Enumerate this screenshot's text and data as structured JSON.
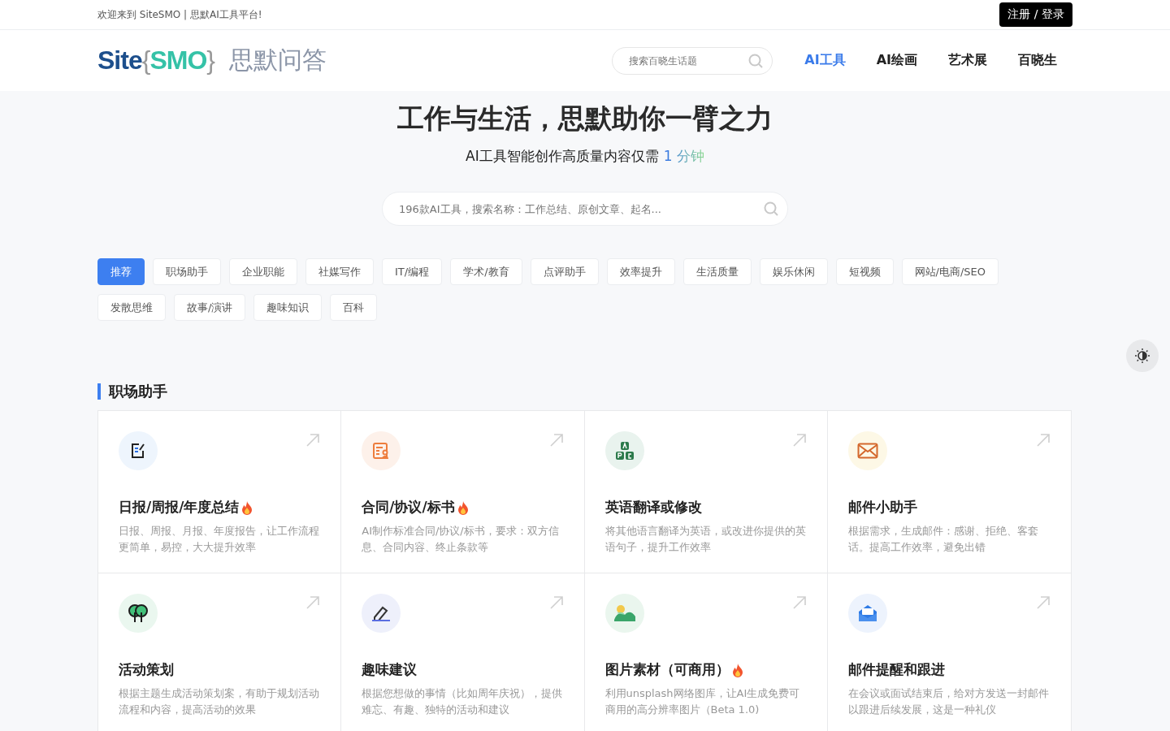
{
  "top_bar": {
    "welcome": "欢迎来到 SiteSMO | 思默AI工具平台!",
    "auth_button": "注册 / 登录"
  },
  "header": {
    "logo": {
      "site": "Site",
      "brace_open": "{",
      "smo": "SMO",
      "brace_close": "}",
      "name": "思默问答"
    },
    "search": {
      "placeholder": "搜索百晓生话题"
    },
    "nav": [
      {
        "label": "AI工具",
        "selected": true
      },
      {
        "label": "AI绘画",
        "selected": false
      },
      {
        "label": "艺术展",
        "selected": false
      },
      {
        "label": "百晓生",
        "selected": false
      }
    ]
  },
  "hero": {
    "title": "工作与生活，思默助你一臂之力",
    "subtitle": "AI工具智能创作高质量内容仅需",
    "subtitle_highlight": "1 分钟",
    "search": {
      "placeholder": "196款AI工具，搜索名称：工作总结、原创文章、起名..."
    }
  },
  "tags": [
    {
      "label": "推荐",
      "selected": true
    },
    {
      "label": "职场助手",
      "selected": false
    },
    {
      "label": "企业职能",
      "selected": false
    },
    {
      "label": "社媒写作",
      "selected": false
    },
    {
      "label": "IT/编程",
      "selected": false
    },
    {
      "label": "学术/教育",
      "selected": false
    },
    {
      "label": "点评助手",
      "selected": false
    },
    {
      "label": "效率提升",
      "selected": false
    },
    {
      "label": "生活质量",
      "selected": false
    },
    {
      "label": "娱乐休闲",
      "selected": false
    },
    {
      "label": "短视频",
      "selected": false
    },
    {
      "label": "网站/电商/SEO",
      "selected": false
    },
    {
      "label": "发散思维",
      "selected": false
    },
    {
      "label": "故事/演讲",
      "selected": false
    },
    {
      "label": "趣味知识",
      "selected": false
    },
    {
      "label": "百科",
      "selected": false
    }
  ],
  "section": {
    "title": "职场助手",
    "cards": [
      {
        "kind": "document",
        "color": "#eef5fd",
        "title": "日报/周报/年度总结",
        "hot": true,
        "description": "日报、周报、月报、年度报告，让工作流程更简单，易控，大大提升效率"
      },
      {
        "kind": "contract",
        "color": "#fdf1ea",
        "title": "合同/协议/标书",
        "hot": true,
        "description": "AI制作标准合同/协议/标书，要求：双方信息、合同内容、终止条款等"
      },
      {
        "kind": "letters",
        "color": "#e9f3ee",
        "title": "英语翻译或修改",
        "hot": false,
        "description": "将其他语言翻译为英语，或改进你提供的英语句子，提升工作效率"
      },
      {
        "kind": "mail",
        "color": "#fdf8e6",
        "title": "邮件小助手",
        "hot": false,
        "description": "根据需求，生成邮件：感谢、拒绝、客套话。提高工作效率，避免出错"
      },
      {
        "kind": "tree",
        "color": "#eaf7ef",
        "title": "活动策划",
        "hot": false,
        "description": "根据主题生成活动策划案，有助于规划活动流程和内容，提高活动的效果"
      },
      {
        "kind": "pen",
        "color": "#eef0fb",
        "title": "趣味建议",
        "hot": false,
        "description": "根据您想做的事情（比如周年庆祝），提供难忘、有趣、独特的活动和建议"
      },
      {
        "kind": "picture",
        "color": "#eaf6ee",
        "title": "图片素材（可商用）",
        "hot": true,
        "description": "利用unsplash网络图库，让AI生成免费可商用的高分辨率图片（Beta 1.0)"
      },
      {
        "kind": "envelope",
        "color": "#edf3fd",
        "title": "邮件提醒和跟进",
        "hot": false,
        "description": "在会议或面试结束后，给对方发送一封邮件以跟进后续发展，这是一种礼仪"
      }
    ]
  }
}
